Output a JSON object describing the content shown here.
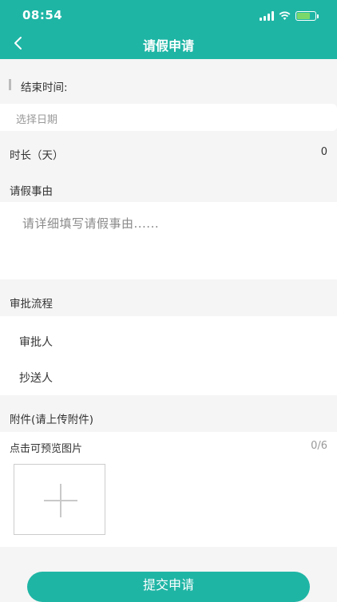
{
  "status_bar": {
    "time": "08:54"
  },
  "nav": {
    "title": "请假申请"
  },
  "form": {
    "end_time_label": "结束时间:",
    "date_placeholder": "选择日期",
    "duration_label": "时长（天）",
    "duration_value": "0",
    "reason_label": "请假事由",
    "reason_placeholder": "请详细填写请假事由......",
    "approval_flow_label": "审批流程",
    "approver_label": "审批人",
    "cc_label": "抄送人",
    "attachment_label": "附件(请上传附件)",
    "preview_hint": "点击可预览图片",
    "attachment_count": "0/6"
  },
  "submit_label": "提交申请",
  "colors": {
    "primary": "#1fb5a5",
    "background": "#f5f5f5"
  }
}
